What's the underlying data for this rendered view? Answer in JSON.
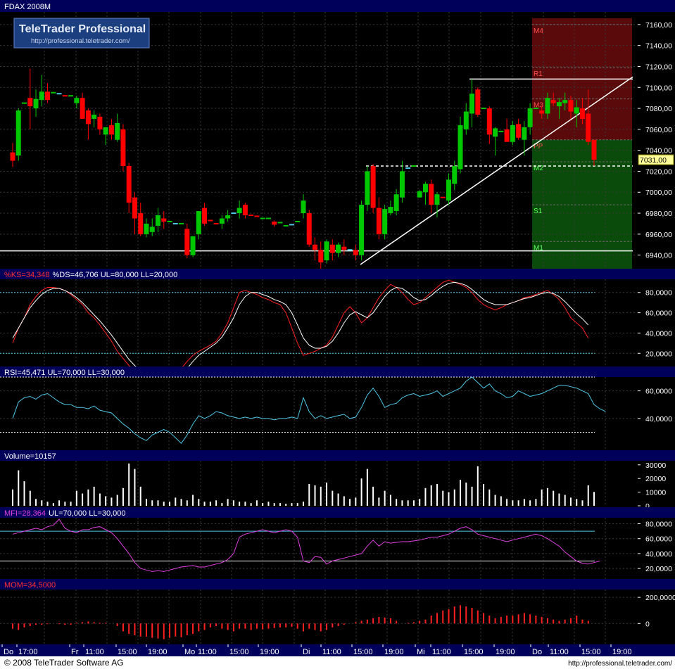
{
  "instrument": "FDAX 2008M",
  "logo": {
    "title": "TeleTrader Professional",
    "url": "http://professional.teletrader.com/"
  },
  "footer": {
    "copyright": "© 2008 TeleTrader Software AG",
    "url": "http://professional.teletrader.com/"
  },
  "colors": {
    "background": "#000000",
    "panel_header": "#00005a",
    "up_candle": "#00c800",
    "down_candle": "#ff0000",
    "cyan": "#4ec8e6",
    "magenta": "#e040e0",
    "grid": "#3a3a3a"
  },
  "x_axis": {
    "labels": [
      "Do",
      "17:00",
      "Fr",
      "11:00",
      "15:00",
      "19:00",
      "Mo",
      "11:00",
      "15:00",
      "19:00",
      "Di",
      "11:00",
      "15:00",
      "19:00",
      "Mi",
      "11:00",
      "15:00",
      "19:00",
      "Do",
      "11:00",
      "15:00",
      "19:00"
    ]
  },
  "panels": {
    "price": {
      "yticks": [
        "7160,00",
        "7140,00",
        "7120,00",
        "7100,00",
        "7080,00",
        "7060,00",
        "7040,00",
        "7020,00",
        "7000,00",
        "6980,00",
        "6960,00",
        "6940,00"
      ],
      "current_price": "7031,00",
      "pivots": [
        {
          "label": "M4",
          "value": 7160
        },
        {
          "label": "R1",
          "value": 7119
        },
        {
          "label": "M3",
          "value": 7089
        },
        {
          "label": "PP",
          "value": 7050
        },
        {
          "label": "M2",
          "value": 7029
        },
        {
          "label": "S1",
          "value": 6988
        },
        {
          "label": "M1",
          "value": 6953
        }
      ]
    },
    "stoch": {
      "header_k": "%KS=34,348",
      "header_rest": "%DS=46,706 UL=80,000 LL=20,000",
      "yticks": [
        "80,0000",
        "60,0000",
        "40,0000",
        "20,0000"
      ],
      "ul": 80,
      "ll": 20
    },
    "rsi": {
      "header": "RSI=45,471 UL=70,000 LL=30,000",
      "yticks": [
        "60,0000",
        "40,0000"
      ],
      "ul": 70,
      "ll": 30
    },
    "volume": {
      "header": "Volume=10157",
      "yticks": [
        "30000",
        "20000",
        "10000",
        "0"
      ]
    },
    "mfi": {
      "header_label": "MFI=28,364",
      "header_rest": "UL=70,000 LL=30,000",
      "yticks": [
        "80,0000",
        "60,0000",
        "40,0000",
        "20,0000"
      ],
      "ul": 70,
      "ll": 30
    },
    "mom": {
      "header": "MOM=34,5000",
      "yticks": [
        "200,0000",
        "0"
      ]
    }
  },
  "chart_data": {
    "type": "candlestick",
    "title": "FDAX 2008M",
    "price_range": [
      6927,
      7172
    ],
    "candles": [
      [
        7038,
        7047,
        7024,
        7030
      ],
      [
        7035,
        7080,
        7030,
        7078
      ],
      [
        7085,
        7105,
        7070,
        7085
      ],
      [
        7090,
        7118,
        7060,
        7082
      ],
      [
        7080,
        7098,
        7072,
        7089
      ],
      [
        7088,
        7112,
        7082,
        7096
      ],
      [
        7096,
        7104,
        7085,
        7088
      ],
      [
        7093,
        7111,
        7086,
        7095
      ],
      [
        7095,
        7100,
        7088,
        7094
      ],
      [
        7093,
        7094,
        7092,
        7092
      ],
      [
        7090,
        7095,
        7088,
        7092
      ],
      [
        7085,
        7092,
        7080,
        7090
      ],
      [
        7090,
        7095,
        7070,
        7070
      ],
      [
        7078,
        7080,
        7050,
        7065
      ],
      [
        7070,
        7078,
        7062,
        7074
      ],
      [
        7072,
        7075,
        7055,
        7060
      ],
      [
        7055,
        7062,
        7045,
        7062
      ],
      [
        7064,
        7070,
        7050,
        7055
      ],
      [
        7050,
        7075,
        7048,
        7066
      ],
      [
        7060,
        7065,
        7020,
        7025
      ],
      [
        7025,
        7028,
        6980,
        6990
      ],
      [
        6995,
        7000,
        6960,
        6975
      ],
      [
        6980,
        6990,
        6958,
        6960
      ],
      [
        6960,
        6975,
        6957,
        6970
      ],
      [
        6962,
        6975,
        6958,
        6967
      ],
      [
        6968,
        6985,
        6962,
        6978
      ],
      [
        6975,
        6982,
        6965,
        6972
      ],
      [
        6972,
        6972,
        6971,
        6972
      ],
      [
        6970,
        6971,
        6969,
        6970
      ],
      [
        6970,
        6971,
        6969,
        6970
      ],
      [
        6965,
        6970,
        6937,
        6940
      ],
      [
        6940,
        6958,
        6938,
        6958
      ],
      [
        6960,
        6982,
        6955,
        6982
      ],
      [
        6985,
        6990,
        6968,
        6970
      ],
      [
        6975,
        6985,
        6968,
        6973
      ],
      [
        6972,
        6975,
        6970,
        6970
      ],
      [
        6970,
        6978,
        6965,
        6975
      ],
      [
        6975,
        6983,
        6972,
        6978
      ],
      [
        6980,
        6984,
        6976,
        6980
      ],
      [
        6980,
        6992,
        6975,
        6985
      ],
      [
        6988,
        6990,
        6975,
        6978
      ],
      [
        6980,
        6983,
        6976,
        6978
      ],
      [
        6978,
        6980,
        6976,
        6977
      ],
      [
        6975,
        6978,
        6969,
        6975
      ],
      [
        6975,
        6976,
        6974,
        6975
      ],
      [
        6972,
        6973,
        6967,
        6969
      ],
      [
        6971,
        6972,
        6970,
        6971
      ],
      [
        6968,
        6969,
        6967,
        6968
      ],
      [
        6970,
        6972,
        6968,
        6969
      ],
      [
        6970,
        6975,
        6967,
        6972
      ],
      [
        6980,
        6998,
        6975,
        6992
      ],
      [
        6980,
        6983,
        6948,
        6950
      ],
      [
        6950,
        6957,
        6935,
        6945
      ],
      [
        6945,
        6953,
        6927,
        6933
      ],
      [
        6935,
        6955,
        6932,
        6953
      ],
      [
        6950,
        6955,
        6935,
        6942
      ],
      [
        6942,
        6952,
        6938,
        6950
      ],
      [
        6948,
        6955,
        6940,
        6945
      ],
      [
        6945,
        6952,
        6938,
        6945
      ],
      [
        6945,
        6950,
        6935,
        6940
      ],
      [
        6940,
        6992,
        6935,
        6988
      ],
      [
        6988,
        7025,
        6982,
        7020
      ],
      [
        7025,
        7027,
        6980,
        6985
      ],
      [
        6985,
        6995,
        6955,
        6960
      ],
      [
        6960,
        6988,
        6955,
        6984
      ],
      [
        6980,
        6992,
        6978,
        6986
      ],
      [
        6982,
        7003,
        6978,
        6998
      ],
      [
        6995,
        7030,
        6990,
        7020
      ],
      [
        7022,
        7025,
        7020,
        7023
      ],
      [
        7025,
        7026,
        7024,
        7025
      ],
      [
        6995,
        7002,
        6995,
        7001
      ],
      [
        7000,
        7010,
        6988,
        7008
      ],
      [
        7008,
        7012,
        6980,
        6988
      ],
      [
        6988,
        7000,
        6976,
        6998
      ],
      [
        6996,
        7002,
        6990,
        6995
      ],
      [
        6992,
        7018,
        6988,
        7012
      ],
      [
        7008,
        7030,
        7002,
        7025
      ],
      [
        7022,
        7072,
        7018,
        7064
      ],
      [
        7060,
        7085,
        7055,
        7077
      ],
      [
        7075,
        7108,
        7062,
        7094
      ],
      [
        7098,
        7100,
        7072,
        7074
      ],
      [
        7080,
        7090,
        7062,
        7080
      ],
      [
        7080,
        7082,
        7046,
        7055
      ],
      [
        7053,
        7062,
        7035,
        7061
      ],
      [
        7058,
        7062,
        7048,
        7058
      ],
      [
        7060,
        7070,
        7048,
        7048
      ],
      [
        7048,
        7068,
        7045,
        7064
      ],
      [
        7065,
        7070,
        7050,
        7052
      ],
      [
        7050,
        7068,
        7035,
        7062
      ],
      [
        7062,
        7085,
        7055,
        7080
      ],
      [
        7080,
        7082,
        7078,
        7080
      ],
      [
        7078,
        7082,
        7070,
        7075
      ],
      [
        7075,
        7095,
        7070,
        7090
      ],
      [
        7088,
        7095,
        7082,
        7085
      ],
      [
        7082,
        7090,
        7070,
        7086
      ],
      [
        7085,
        7095,
        7078,
        7088
      ],
      [
        7088,
        7092,
        7070,
        7077
      ],
      [
        7075,
        7088,
        7062,
        7081
      ],
      [
        7080,
        7090,
        7065,
        7070
      ],
      [
        7075,
        7098,
        7045,
        7048
      ],
      [
        7050,
        7050,
        7025,
        7031
      ]
    ],
    "stoch_k": [
      30,
      45,
      55,
      68,
      76,
      82,
      85,
      85,
      84,
      82,
      78,
      73,
      68,
      60,
      55,
      48,
      40,
      32,
      22,
      15,
      8,
      3,
      -2,
      -5,
      -10,
      -12,
      -14,
      -12,
      -8,
      5,
      12,
      18,
      22,
      25,
      28,
      32,
      40,
      50,
      65,
      80,
      82,
      80,
      78,
      75,
      73,
      70,
      68,
      60,
      45,
      30,
      18,
      20,
      22,
      25,
      28,
      36,
      48,
      60,
      66,
      60,
      50,
      55,
      65,
      75,
      82,
      88,
      85,
      80,
      73,
      68,
      70,
      75,
      80,
      85,
      90,
      92,
      90,
      88,
      85,
      80,
      73,
      68,
      65,
      63,
      65,
      68,
      70,
      72,
      75,
      76,
      78,
      80,
      82,
      78,
      73,
      65,
      55,
      50,
      45,
      35
    ],
    "stoch_d": [
      35,
      45,
      55,
      65,
      72,
      78,
      82,
      84,
      84,
      82,
      79,
      75,
      70,
      64,
      58,
      52,
      45,
      38,
      30,
      22,
      14,
      8,
      2,
      -3,
      -6,
      -9,
      -11,
      -11,
      -9,
      -2,
      5,
      12,
      18,
      22,
      26,
      30,
      36,
      45,
      55,
      68,
      76,
      80,
      80,
      78,
      76,
      73,
      71,
      68,
      60,
      48,
      35,
      28,
      25,
      25,
      27,
      32,
      40,
      50,
      58,
      61,
      58,
      55,
      60,
      68,
      76,
      82,
      85,
      84,
      80,
      75,
      72,
      73,
      77,
      82,
      86,
      89,
      90,
      89,
      87,
      83,
      78,
      73,
      70,
      68,
      68,
      68,
      70,
      72,
      74,
      75,
      77,
      79,
      80,
      79,
      76,
      71,
      65,
      59,
      54,
      48
    ],
    "rsi": [
      40,
      52,
      55,
      56,
      54,
      57,
      58,
      55,
      52,
      50,
      50,
      48,
      48,
      47,
      49,
      46,
      45,
      44,
      40,
      36,
      33,
      29,
      26,
      24,
      28,
      30,
      32,
      30,
      26,
      22,
      28,
      36,
      42,
      40,
      42,
      45,
      44,
      42,
      41,
      40,
      41,
      40,
      41,
      40,
      40,
      39,
      40,
      40,
      41,
      40,
      55,
      45,
      40,
      42,
      40,
      41,
      42,
      43,
      40,
      41,
      48,
      57,
      62,
      56,
      48,
      50,
      51,
      55,
      57,
      58,
      56,
      57,
      58,
      60,
      56,
      58,
      60,
      62,
      67,
      70,
      66,
      62,
      65,
      60,
      58,
      55,
      56,
      60,
      58,
      56,
      57,
      58,
      60,
      62,
      64,
      64,
      63,
      62,
      60,
      58,
      50,
      47,
      45
    ],
    "volume": [
      12000,
      26000,
      18000,
      11000,
      5000,
      4000,
      3000,
      2000,
      4000,
      3000,
      3000,
      11000,
      9000,
      12000,
      14000,
      9000,
      7000,
      6000,
      8000,
      13000,
      31000,
      27000,
      14000,
      5000,
      4000,
      4000,
      3000,
      3000,
      6000,
      5000,
      4000,
      8000,
      5000,
      3000,
      3000,
      4000,
      2000,
      5000,
      4000,
      3000,
      3000,
      2000,
      4000,
      2000,
      3000,
      2000,
      2000,
      1500,
      2000,
      2000,
      3000,
      16000,
      15000,
      14000,
      17000,
      11000,
      9000,
      7000,
      5000,
      6000,
      20000,
      27000,
      14000,
      6000,
      11000,
      8000,
      5000,
      4000,
      4000,
      4000,
      5000,
      13000,
      15000,
      16000,
      11000,
      10000,
      12000,
      19000,
      17000,
      14000,
      29000,
      16000,
      12000,
      8000,
      7000,
      5000,
      4000,
      4000,
      5000,
      4000,
      5000,
      12000,
      13000,
      11000,
      9000,
      8000,
      6000,
      5000,
      4000,
      15000,
      10157
    ],
    "mfi": [
      66,
      68,
      70,
      72,
      74,
      72,
      76,
      78,
      86,
      74,
      70,
      68,
      72,
      72,
      75,
      76,
      72,
      68,
      60,
      50,
      40,
      28,
      20,
      18,
      16,
      17,
      16,
      18,
      20,
      22,
      23,
      24,
      22,
      22,
      24,
      26,
      28,
      32,
      40,
      62,
      66,
      68,
      70,
      72,
      70,
      68,
      70,
      72,
      70,
      62,
      30,
      28,
      36,
      35,
      26,
      30,
      32,
      34,
      36,
      38,
      40,
      50,
      58,
      50,
      56,
      54,
      55,
      56,
      56,
      57,
      58,
      60,
      62,
      62,
      64,
      66,
      70,
      74,
      76,
      72,
      66,
      64,
      62,
      60,
      58,
      56,
      58,
      60,
      62,
      64,
      66,
      64,
      60,
      55,
      50,
      42,
      36,
      30,
      27,
      26,
      28,
      30
    ],
    "mom": [
      -40,
      -50,
      -30,
      -20,
      -10,
      -10,
      -5,
      0,
      -5,
      -10,
      -10,
      5,
      10,
      15,
      10,
      5,
      5,
      0,
      -20,
      -60,
      -80,
      -90,
      -100,
      -100,
      -110,
      -115,
      -120,
      -110,
      -100,
      -105,
      -90,
      -80,
      -60,
      -50,
      -30,
      -20,
      -40,
      -50,
      -60,
      -40,
      -40,
      -50,
      -40,
      -45,
      -40,
      -35,
      -30,
      -30,
      -25,
      -40,
      -60,
      -40,
      -50,
      -60,
      -50,
      -30,
      -20,
      -10,
      0,
      10,
      20,
      30,
      40,
      50,
      45,
      40,
      20,
      0,
      5,
      10,
      20,
      30,
      60,
      80,
      100,
      110,
      130,
      140,
      130,
      120,
      100,
      80,
      60,
      40,
      50,
      60,
      60,
      70,
      80,
      70,
      60,
      50,
      40,
      30,
      20,
      30,
      40,
      60,
      30,
      20
    ]
  }
}
